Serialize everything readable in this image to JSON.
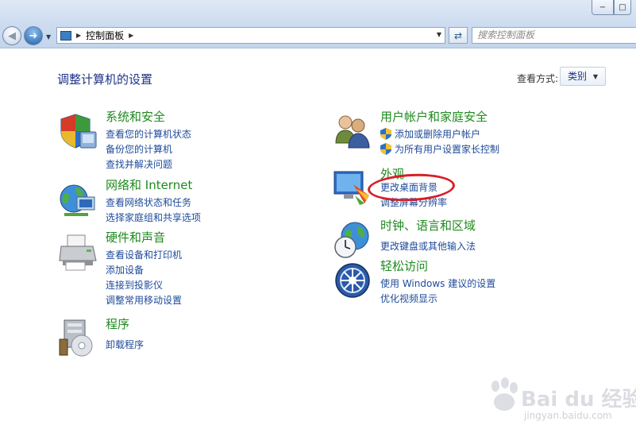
{
  "window": {
    "min_glyph": "−",
    "max_glyph": "□"
  },
  "toolbar": {
    "back_glyph": "◀",
    "forward_glyph": "➜",
    "breadcrumb": "控制面板",
    "search_placeholder": "搜索控制面板",
    "refresh_glyph": "⇄"
  },
  "main": {
    "heading": "调整计算机的设置",
    "view_label": "查看方式:",
    "view_value": "类别"
  },
  "categories": {
    "system": {
      "title": "系统和安全",
      "links": [
        "查看您的计算机状态",
        "备份您的计算机",
        "查找并解决问题"
      ]
    },
    "network": {
      "title": "网络和 Internet",
      "links": [
        "查看网络状态和任务",
        "选择家庭组和共享选项"
      ]
    },
    "hardware": {
      "title": "硬件和声音",
      "links": [
        "查看设备和打印机",
        "添加设备",
        "连接到投影仪",
        "调整常用移动设置"
      ]
    },
    "programs": {
      "title": "程序",
      "links": [
        "卸载程序"
      ]
    },
    "users": {
      "title": "用户帐户和家庭安全",
      "links": [
        "添加或删除用户帐户",
        "为所有用户设置家长控制"
      ]
    },
    "appearance": {
      "title": "外观",
      "links": [
        "更改桌面背景",
        "调整屏幕分辨率"
      ]
    },
    "clock": {
      "title": "时钟、语言和区域",
      "links": [
        "更改键盘或其他输入法"
      ]
    },
    "ease": {
      "title": "轻松访问",
      "links": [
        "使用 Windows 建议的设置",
        "优化视频显示"
      ]
    }
  },
  "watermark": {
    "brand": "Bai  du 经验",
    "url": "jingyan.baidu.com"
  },
  "colors": {
    "title_green": "#1e8a1e",
    "link_blue": "#1e4a9a",
    "heading_blue": "#1e3287",
    "annotation_red": "#d62027"
  }
}
